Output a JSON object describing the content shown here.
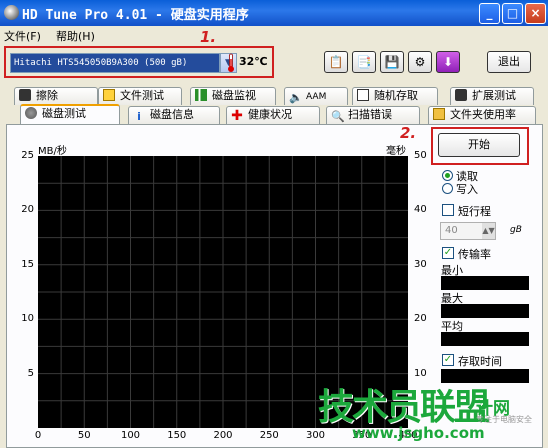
{
  "window": {
    "title": "HD Tune Pro 4.01 - 硬盘实用程序",
    "minimize": "_",
    "maximize": "□",
    "close": "×"
  },
  "menu": {
    "file": "文件(F)",
    "help": "帮助(H)"
  },
  "toolbar": {
    "drive": "Hitachi HTS545050B9A300 (500 gB)",
    "temperature": "32℃",
    "exit_label": "退出"
  },
  "annotations": {
    "one": "1.",
    "two": "2."
  },
  "tabs_top": [
    "擦除",
    "文件测试",
    "磁盘监视",
    "AAM",
    "随机存取",
    "扩展测试"
  ],
  "tabs_bottom": [
    "磁盘测试",
    "磁盘信息",
    "健康状况",
    "扫描错误",
    "文件夹使用率"
  ],
  "chart_data": {
    "type": "line",
    "ylabel_left": "MB/秒",
    "ylabel_right": "毫秒",
    "y_left_ticks": [
      "25",
      "20",
      "15",
      "10",
      "5"
    ],
    "y_right_ticks": [
      "50",
      "40",
      "30",
      "20",
      "10"
    ],
    "x_ticks": [
      "0",
      "50",
      "100",
      "150",
      "200",
      "250",
      "300",
      "350",
      "400"
    ],
    "ylim_left": [
      0,
      25
    ],
    "ylim_right": [
      0,
      50
    ],
    "xlim": [
      0,
      400
    ],
    "grid": true,
    "series": []
  },
  "controls": {
    "start_label": "开始",
    "read_label": "读取",
    "write_label": "写入",
    "read_selected": true,
    "short_stroke_label": "短行程",
    "short_stroke_value": "40",
    "short_stroke_unit": "gB",
    "transfer_rate_label": "传输率",
    "min_label": "最小",
    "max_label": "最大",
    "avg_label": "平均",
    "access_time_label": "存取时间"
  },
  "watermark": {
    "logo": "技术员联盟",
    "small": "计网",
    "url": "www.jsgho.com",
    "tiny": "专注于电脑安全"
  }
}
